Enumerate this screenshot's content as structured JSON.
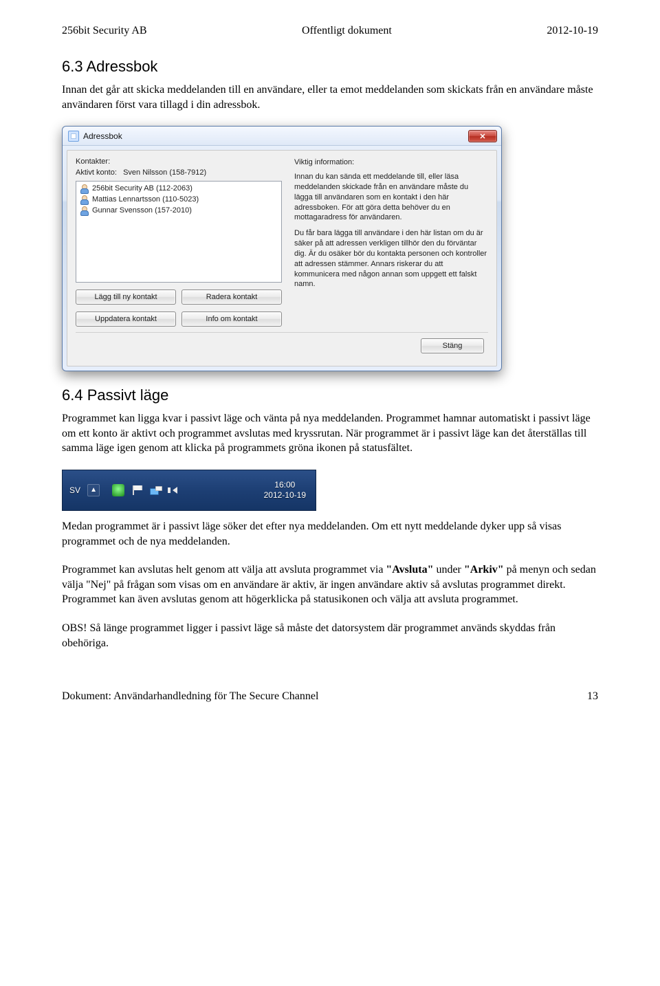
{
  "header": {
    "left": "256bit Security AB",
    "center": "Offentligt dokument",
    "right": "2012-10-19"
  },
  "section1": {
    "title": "6.3 Adressbok",
    "p": "Innan det går att skicka meddelanden till en användare, eller ta emot meddelanden som skickats från en användare måste användaren först vara tillagd i din adressbok."
  },
  "dialog": {
    "title": "Adressbok",
    "left_label": "Kontakter:",
    "active_label": "Aktivt konto:",
    "active_value": "Sven Nilsson (158-7912)",
    "contacts": [
      "256bit Security AB (112-2063)",
      "Mattias Lennartsson (110-5023)",
      "Gunnar Svensson (157-2010)"
    ],
    "buttons": {
      "add": "Lägg till ny kontakt",
      "remove": "Radera kontakt",
      "update": "Uppdatera kontakt",
      "info": "Info om kontakt",
      "close": "Stäng"
    },
    "right_label": "Viktig information:",
    "right_p1": "Innan du kan sända ett meddelande till, eller läsa meddelanden skickade från en användare måste du lägga till användaren som en kontakt i den här adressboken. För att göra detta behöver du en mottagaradress för användaren.",
    "right_p2": "Du får bara lägga till användare i den här listan om du är säker på att adressen verkligen tillhör den du förväntar dig. Är du osäker bör du kontakta personen och kontroller att adressen stämmer. Annars riskerar du att kommunicera med någon annan som uppgett ett falskt namn."
  },
  "section2": {
    "title": "6.4 Passivt läge",
    "p": "Programmet kan ligga kvar i passivt läge och vänta på nya meddelanden. Programmet hamnar automatiskt i passivt läge om ett konto är aktivt och programmet avslutas med kryssrutan. När programmet är i passivt läge kan det återställas till samma läge igen genom att klicka på programmets gröna ikonen på statusfältet."
  },
  "tray": {
    "lang": "SV",
    "time": "16:00",
    "date": "2012-10-19"
  },
  "after_tray": {
    "p1": "Medan programmet är i passivt läge söker det efter nya meddelanden. Om ett nytt meddelande dyker upp så visas programmet och de nya meddelanden.",
    "p2a": "Programmet kan avslutas helt genom att välja att avsluta programmet via ",
    "p2b_bold": "\"Avsluta\"",
    "p2c": " under ",
    "p2d_bold": "\"Arkiv\"",
    "p2e": " på menyn och sedan välja \"Nej\" på frågan som visas om en användare är aktiv, är ingen användare aktiv så avslutas programmet direkt. Programmet kan även avslutas genom att högerklicka på statusikonen och välja att avsluta programmet.",
    "p3": "OBS! Så länge programmet ligger i passivt läge så måste det datorsystem där programmet används skyddas från obehöriga."
  },
  "footer": {
    "left": "Dokument: Användarhandledning för The Secure Channel",
    "right": "13"
  }
}
